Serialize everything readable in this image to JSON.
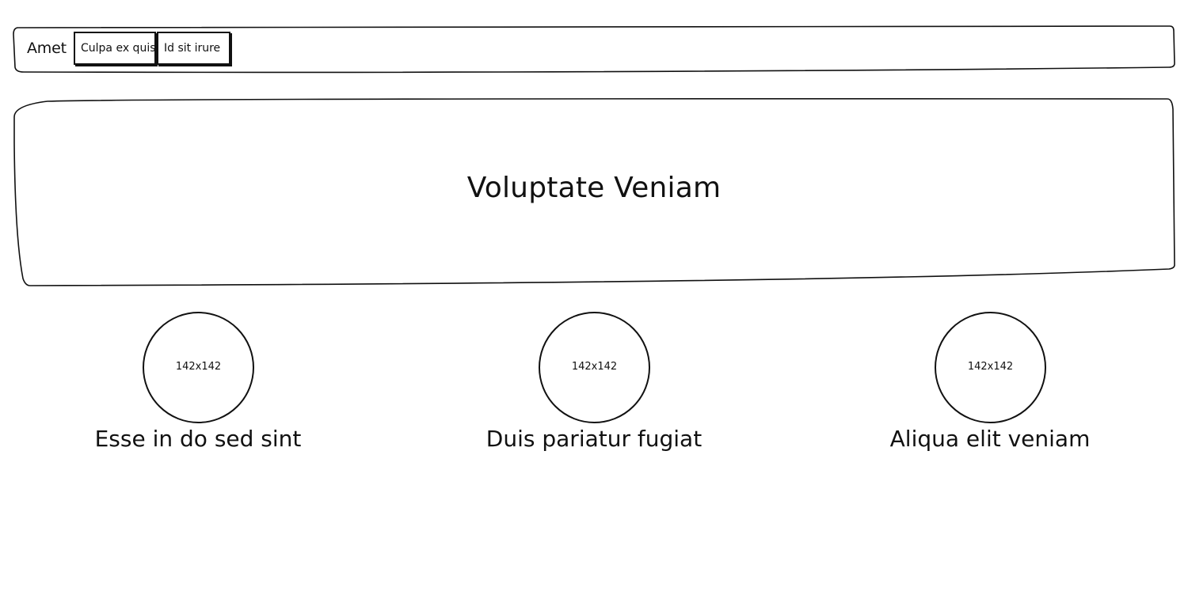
{
  "navbar": {
    "brand": "Amet",
    "buttons": [
      {
        "label": "Culpa ex quis"
      },
      {
        "label": "Id sit irure"
      }
    ]
  },
  "hero": {
    "title": "Voluptate Veniam"
  },
  "features": [
    {
      "image_label": "142x142",
      "caption": "Esse in do sed sint"
    },
    {
      "image_label": "142x142",
      "caption": "Duis pariatur fugiat"
    },
    {
      "image_label": "142x142",
      "caption": "Aliqua elit veniam"
    }
  ]
}
